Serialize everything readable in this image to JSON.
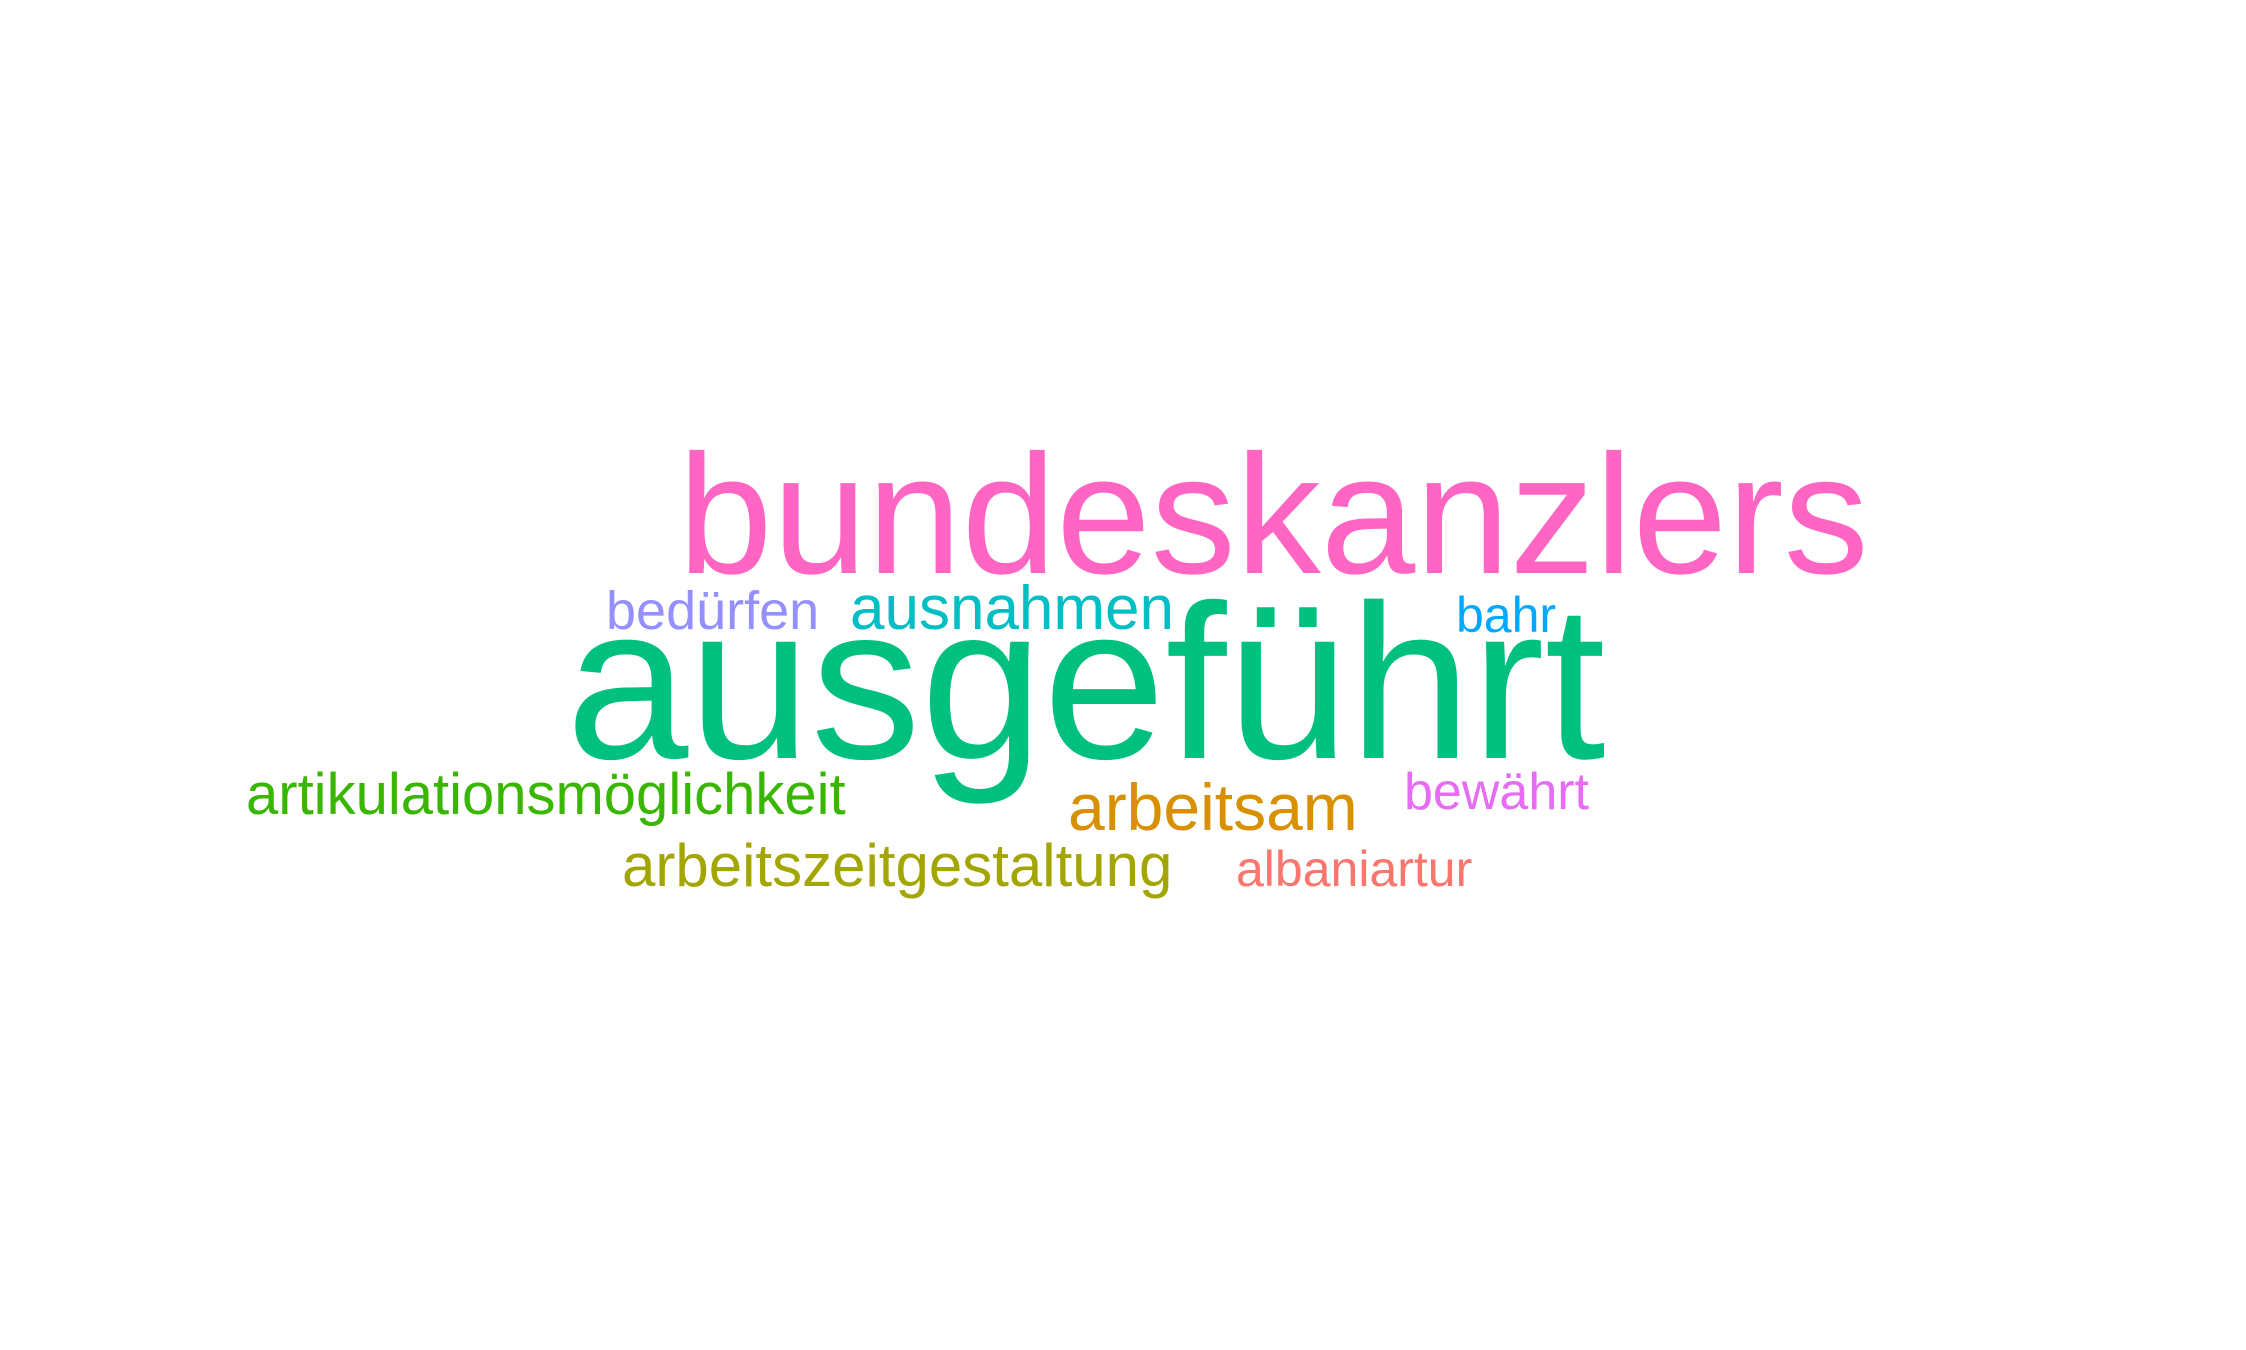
{
  "wordcloud": {
    "words": [
      {
        "text": "bundeskanzlers",
        "color": "#ff66c4"
      },
      {
        "text": "ausgeführt",
        "color": "#00c07f"
      },
      {
        "text": "bedürfen",
        "color": "#9590ff"
      },
      {
        "text": "ausnahmen",
        "color": "#00bfc4"
      },
      {
        "text": "bahr",
        "color": "#00a9ff"
      },
      {
        "text": "artikulationsmöglichkeit",
        "color": "#39b600"
      },
      {
        "text": "arbeitsam",
        "color": "#d89000"
      },
      {
        "text": "bewährt",
        "color": "#e76bf3"
      },
      {
        "text": "arbeitszeitgestaltung",
        "color": "#a3a500"
      },
      {
        "text": "albaniartur",
        "color": "#f8766d"
      }
    ]
  }
}
